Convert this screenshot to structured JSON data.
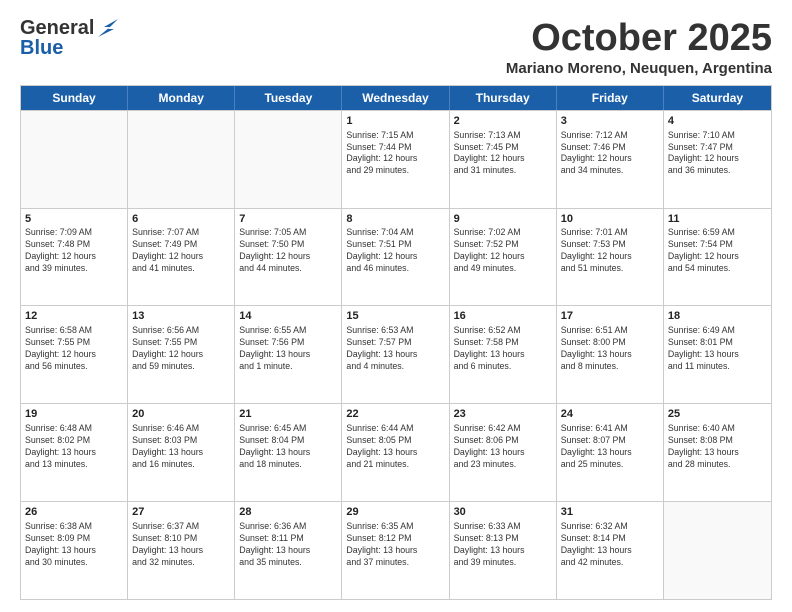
{
  "logo": {
    "general": "General",
    "blue": "Blue"
  },
  "title": "October 2025",
  "subtitle": "Mariano Moreno, Neuquen, Argentina",
  "days": [
    "Sunday",
    "Monday",
    "Tuesday",
    "Wednesday",
    "Thursday",
    "Friday",
    "Saturday"
  ],
  "weeks": [
    [
      {
        "day": "",
        "info": ""
      },
      {
        "day": "",
        "info": ""
      },
      {
        "day": "",
        "info": ""
      },
      {
        "day": "1",
        "info": "Sunrise: 7:15 AM\nSunset: 7:44 PM\nDaylight: 12 hours\nand 29 minutes."
      },
      {
        "day": "2",
        "info": "Sunrise: 7:13 AM\nSunset: 7:45 PM\nDaylight: 12 hours\nand 31 minutes."
      },
      {
        "day": "3",
        "info": "Sunrise: 7:12 AM\nSunset: 7:46 PM\nDaylight: 12 hours\nand 34 minutes."
      },
      {
        "day": "4",
        "info": "Sunrise: 7:10 AM\nSunset: 7:47 PM\nDaylight: 12 hours\nand 36 minutes."
      }
    ],
    [
      {
        "day": "5",
        "info": "Sunrise: 7:09 AM\nSunset: 7:48 PM\nDaylight: 12 hours\nand 39 minutes."
      },
      {
        "day": "6",
        "info": "Sunrise: 7:07 AM\nSunset: 7:49 PM\nDaylight: 12 hours\nand 41 minutes."
      },
      {
        "day": "7",
        "info": "Sunrise: 7:05 AM\nSunset: 7:50 PM\nDaylight: 12 hours\nand 44 minutes."
      },
      {
        "day": "8",
        "info": "Sunrise: 7:04 AM\nSunset: 7:51 PM\nDaylight: 12 hours\nand 46 minutes."
      },
      {
        "day": "9",
        "info": "Sunrise: 7:02 AM\nSunset: 7:52 PM\nDaylight: 12 hours\nand 49 minutes."
      },
      {
        "day": "10",
        "info": "Sunrise: 7:01 AM\nSunset: 7:53 PM\nDaylight: 12 hours\nand 51 minutes."
      },
      {
        "day": "11",
        "info": "Sunrise: 6:59 AM\nSunset: 7:54 PM\nDaylight: 12 hours\nand 54 minutes."
      }
    ],
    [
      {
        "day": "12",
        "info": "Sunrise: 6:58 AM\nSunset: 7:55 PM\nDaylight: 12 hours\nand 56 minutes."
      },
      {
        "day": "13",
        "info": "Sunrise: 6:56 AM\nSunset: 7:55 PM\nDaylight: 12 hours\nand 59 minutes."
      },
      {
        "day": "14",
        "info": "Sunrise: 6:55 AM\nSunset: 7:56 PM\nDaylight: 13 hours\nand 1 minute."
      },
      {
        "day": "15",
        "info": "Sunrise: 6:53 AM\nSunset: 7:57 PM\nDaylight: 13 hours\nand 4 minutes."
      },
      {
        "day": "16",
        "info": "Sunrise: 6:52 AM\nSunset: 7:58 PM\nDaylight: 13 hours\nand 6 minutes."
      },
      {
        "day": "17",
        "info": "Sunrise: 6:51 AM\nSunset: 8:00 PM\nDaylight: 13 hours\nand 8 minutes."
      },
      {
        "day": "18",
        "info": "Sunrise: 6:49 AM\nSunset: 8:01 PM\nDaylight: 13 hours\nand 11 minutes."
      }
    ],
    [
      {
        "day": "19",
        "info": "Sunrise: 6:48 AM\nSunset: 8:02 PM\nDaylight: 13 hours\nand 13 minutes."
      },
      {
        "day": "20",
        "info": "Sunrise: 6:46 AM\nSunset: 8:03 PM\nDaylight: 13 hours\nand 16 minutes."
      },
      {
        "day": "21",
        "info": "Sunrise: 6:45 AM\nSunset: 8:04 PM\nDaylight: 13 hours\nand 18 minutes."
      },
      {
        "day": "22",
        "info": "Sunrise: 6:44 AM\nSunset: 8:05 PM\nDaylight: 13 hours\nand 21 minutes."
      },
      {
        "day": "23",
        "info": "Sunrise: 6:42 AM\nSunset: 8:06 PM\nDaylight: 13 hours\nand 23 minutes."
      },
      {
        "day": "24",
        "info": "Sunrise: 6:41 AM\nSunset: 8:07 PM\nDaylight: 13 hours\nand 25 minutes."
      },
      {
        "day": "25",
        "info": "Sunrise: 6:40 AM\nSunset: 8:08 PM\nDaylight: 13 hours\nand 28 minutes."
      }
    ],
    [
      {
        "day": "26",
        "info": "Sunrise: 6:38 AM\nSunset: 8:09 PM\nDaylight: 13 hours\nand 30 minutes."
      },
      {
        "day": "27",
        "info": "Sunrise: 6:37 AM\nSunset: 8:10 PM\nDaylight: 13 hours\nand 32 minutes."
      },
      {
        "day": "28",
        "info": "Sunrise: 6:36 AM\nSunset: 8:11 PM\nDaylight: 13 hours\nand 35 minutes."
      },
      {
        "day": "29",
        "info": "Sunrise: 6:35 AM\nSunset: 8:12 PM\nDaylight: 13 hours\nand 37 minutes."
      },
      {
        "day": "30",
        "info": "Sunrise: 6:33 AM\nSunset: 8:13 PM\nDaylight: 13 hours\nand 39 minutes."
      },
      {
        "day": "31",
        "info": "Sunrise: 6:32 AM\nSunset: 8:14 PM\nDaylight: 13 hours\nand 42 minutes."
      },
      {
        "day": "",
        "info": ""
      }
    ]
  ]
}
